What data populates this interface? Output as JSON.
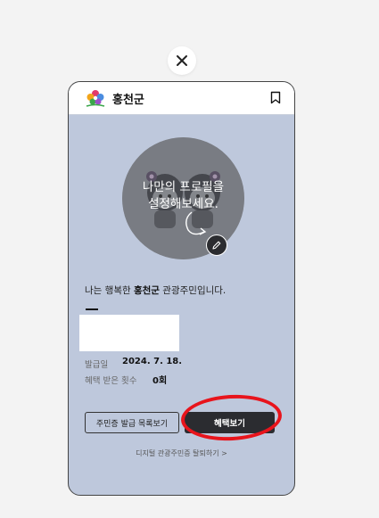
{
  "modal": {
    "close_icon": "close-icon"
  },
  "header": {
    "title": "홍천군",
    "logo_icon": "hongcheon-flower-logo",
    "bookmark_icon": "bookmark-icon"
  },
  "profile": {
    "prompt_line1": "나만의 프로필을",
    "prompt_line2": "설정해보세요.",
    "edit_icon": "pencil-icon",
    "statement_prefix": "나는 행복한 ",
    "statement_region": "홍천군",
    "statement_suffix": " 관광주민입니다."
  },
  "info": {
    "issue_label": "발급일",
    "issue_value": "2024. 7. 18.",
    "benefit_label": "혜택 받은 횟수",
    "benefit_value": "0회"
  },
  "actions": {
    "list_button": "주민증 발급 목록보기",
    "benefit_button": "혜택보기",
    "withdraw_link": "디지털 관광주민증 탈퇴하기 >"
  },
  "colors": {
    "card_bg": "#bec8dc",
    "dark_button": "#2b2c30",
    "annotation_red": "#e8141c"
  }
}
